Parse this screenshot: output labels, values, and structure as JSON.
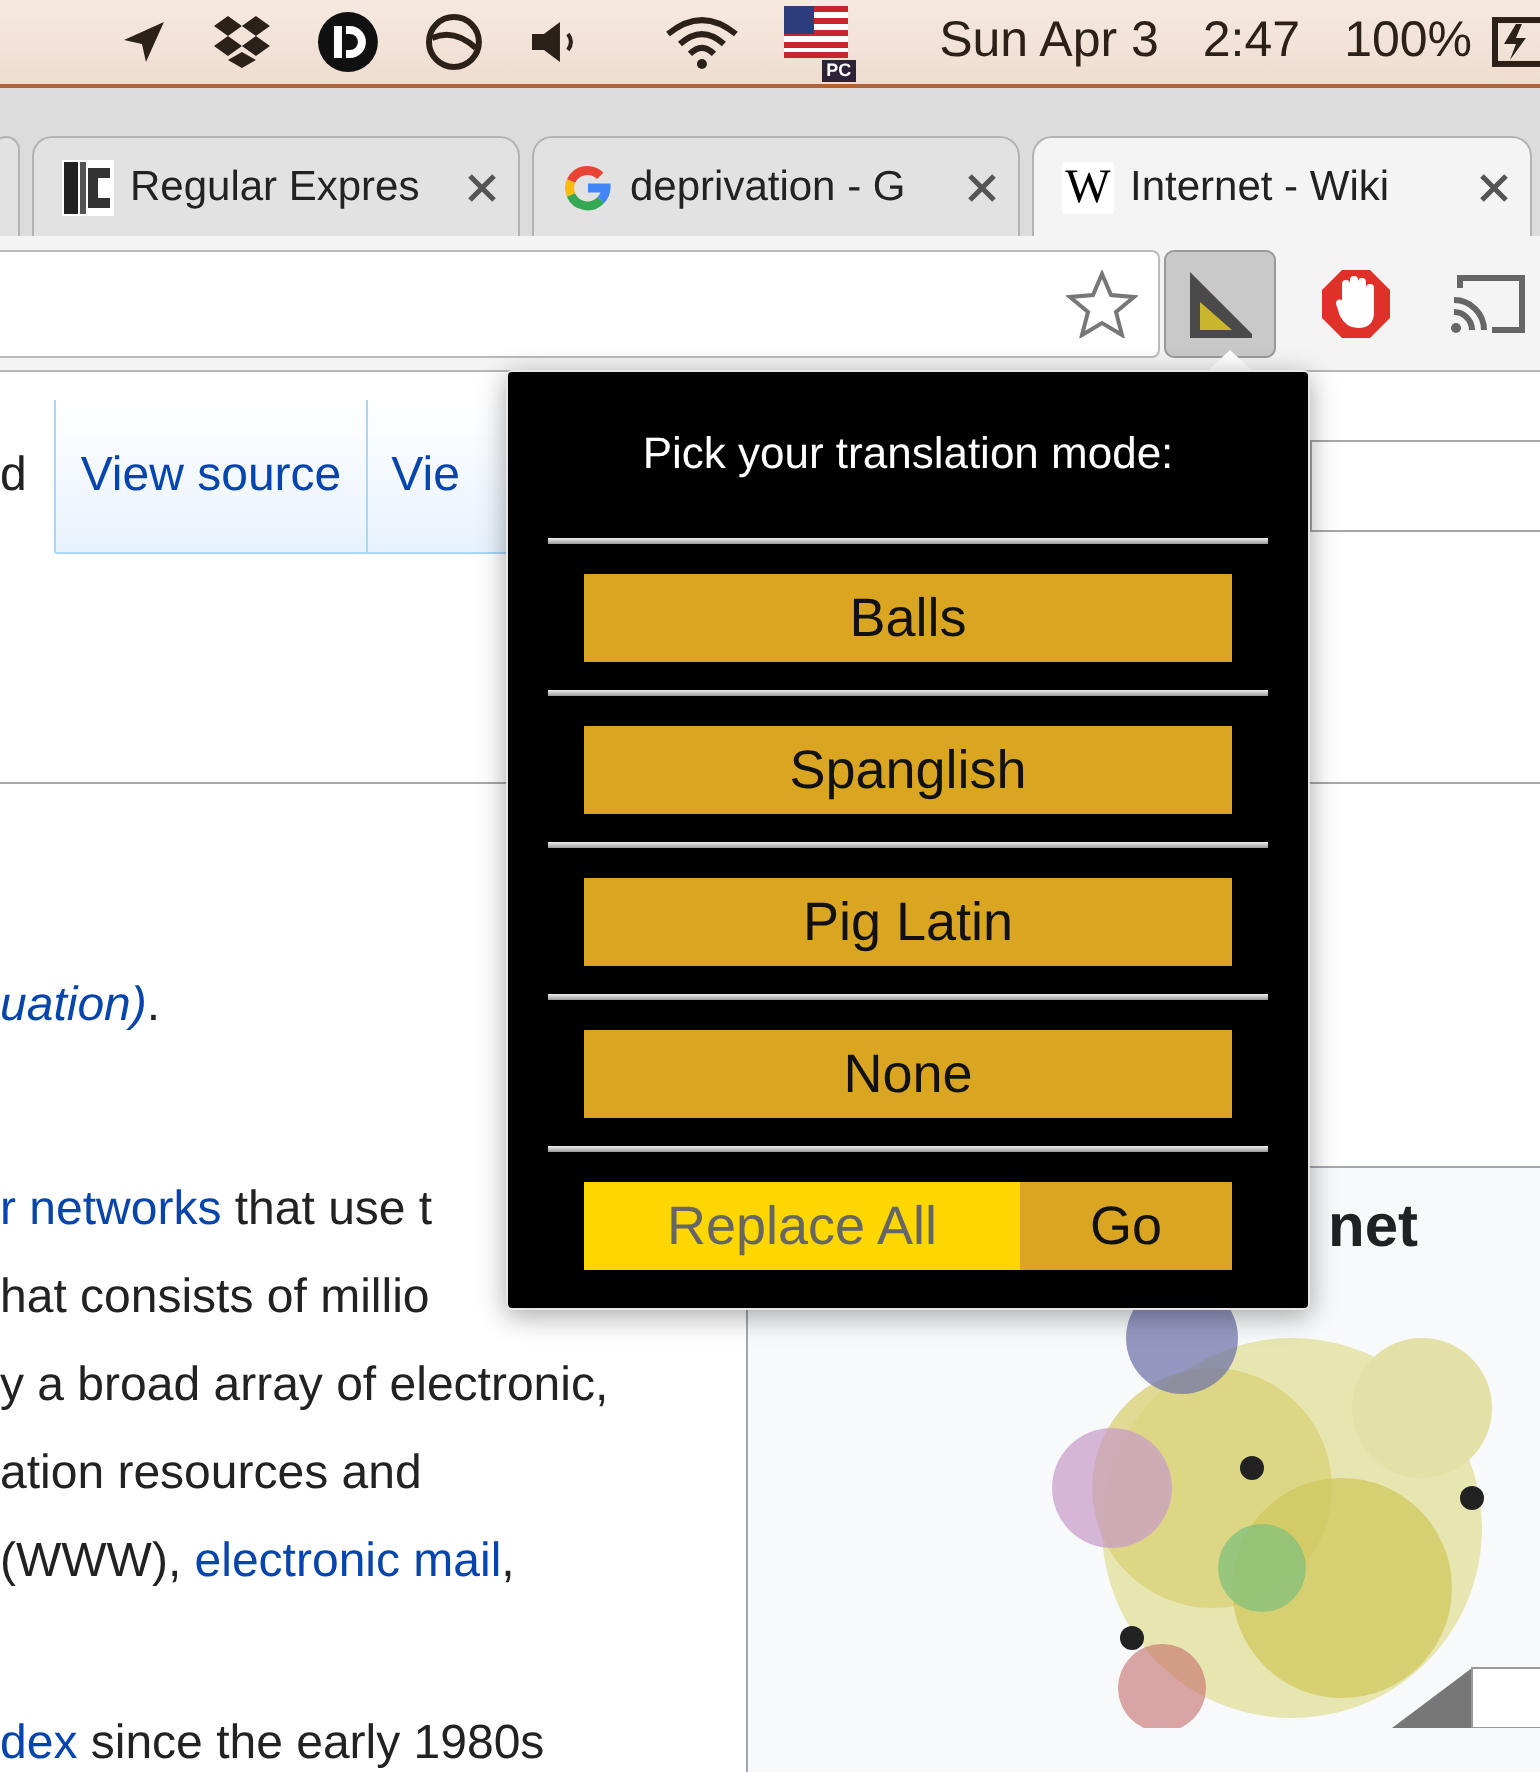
{
  "menu_bar": {
    "input_badge": "PC",
    "date": "Sun Apr 3",
    "time": "2:47",
    "battery": "100%"
  },
  "tabs": [
    {
      "title": "Regular Expres",
      "selected": false,
      "kind": "bracket"
    },
    {
      "title": "deprivation - G",
      "selected": false,
      "kind": "g"
    },
    {
      "title": "Internet - Wiki",
      "selected": true,
      "kind": "letter",
      "icon_text": "W"
    }
  ],
  "toolbar": {
    "extension_pressed": true
  },
  "popup": {
    "title": "Pick your translation mode:",
    "modes": [
      "Balls",
      "Spanglish",
      "Pig Latin",
      "None"
    ],
    "replace_field": {
      "placeholder": "Replace All"
    },
    "go_button": "Go"
  },
  "page": {
    "tabs": [
      {
        "label": "d",
        "selected": true
      },
      {
        "label": "View source",
        "selected": false
      },
      {
        "label": "Vie",
        "selected": false
      }
    ],
    "lines": [
      [
        {
          "kind": "italic-link",
          "text": "uation)"
        },
        {
          "kind": "plain",
          "text": "."
        }
      ],
      [
        {
          "kind": "link",
          "text": "r networks"
        },
        {
          "kind": "plain",
          "text": " that use t"
        }
      ],
      [
        {
          "kind": "plain",
          "text": "hat consists of millio"
        }
      ],
      [
        {
          "kind": "plain",
          "text": "y a broad array of electronic,"
        }
      ],
      [
        {
          "kind": "plain",
          "text": "ation resources and"
        }
      ],
      [
        {
          "kind": "plain",
          "text": "(WWW), "
        },
        {
          "kind": "link",
          "text": "electronic mail"
        },
        {
          "kind": "plain",
          "text": ","
        }
      ],
      [
        {
          "kind": "link",
          "text": "dex"
        },
        {
          "kind": "plain",
          "text": " since the early 1980s"
        }
      ]
    ],
    "infobox": {
      "title": "net"
    }
  }
}
